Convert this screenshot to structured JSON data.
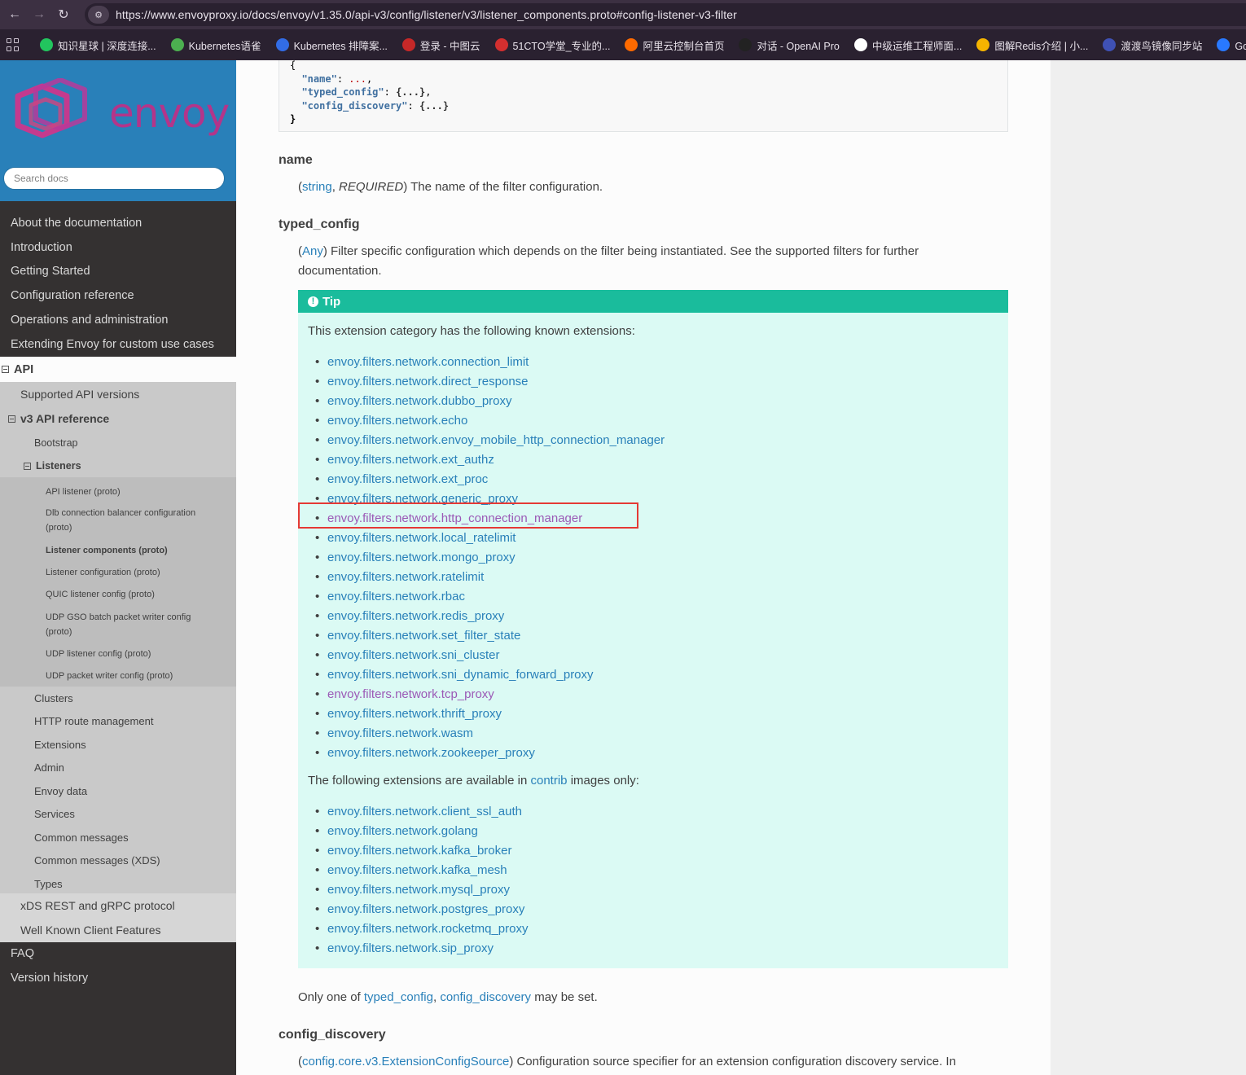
{
  "browser": {
    "url": "https://www.envoyproxy.io/docs/envoy/v1.35.0/api-v3/config/listener/v3/listener_components.proto#config-listener-v3-filter",
    "bookmarks": [
      {
        "label": "知识星球 | 深度连接...",
        "color": "#22c55e"
      },
      {
        "label": "Kubernetes语雀",
        "color": "#4caf50"
      },
      {
        "label": "Kubernetes 排障案...",
        "color": "#326ce5"
      },
      {
        "label": "登录 - 中图云",
        "color": "#c62828"
      },
      {
        "label": "51CTO学堂_专业的...",
        "color": "#d32f2f"
      },
      {
        "label": "阿里云控制台首页",
        "color": "#ff6a00"
      },
      {
        "label": "对话 - OpenAI Pro",
        "color": "#222222"
      },
      {
        "label": "中级运维工程师面...",
        "color": "#ffffff"
      },
      {
        "label": "图解Redis介绍 | 小...",
        "color": "#f5b400"
      },
      {
        "label": "渡渡鸟镜像同步站",
        "color": "#3f51b5"
      },
      {
        "label": "Go 学习",
        "color": "#2979ff"
      }
    ]
  },
  "sidebar": {
    "logo_text": "envoy",
    "search_placeholder": "Search docs",
    "top_items": [
      "About the documentation",
      "Introduction",
      "Getting Started",
      "Configuration reference",
      "Operations and administration",
      "Extending Envoy for custom use cases"
    ],
    "api_label": "API",
    "supported_versions": "Supported API versions",
    "v3_reference": "v3 API reference",
    "bootstrap": "Bootstrap",
    "listeners": "Listeners",
    "listener_children": [
      "API listener (proto)",
      "Dlb connection balancer configuration (proto)",
      "Listener components (proto)",
      "Listener configuration (proto)",
      "QUIC listener config (proto)",
      "UDP GSO batch packet writer config (proto)",
      "UDP listener config (proto)",
      "UDP packet writer config (proto)"
    ],
    "v3_children_after": [
      "Clusters",
      "HTTP route management",
      "Extensions",
      "Admin",
      "Envoy data",
      "Services",
      "Common messages",
      "Common messages (XDS)",
      "Types"
    ],
    "api_children_after": [
      "xDS REST and gRPC protocol",
      "Well Known Client Features"
    ],
    "bottom_items": [
      "FAQ",
      "Version history"
    ]
  },
  "content": {
    "code": {
      "open": "{",
      "name_key": "\"name\"",
      "typed_key": "\"typed_config\"",
      "discovery_key": "\"config_discovery\"",
      "name_val": "...",
      "obj_val": "{...}",
      "close": "}"
    },
    "name_title": "name",
    "name_type": "string",
    "name_required": "REQUIRED",
    "name_desc": ") The name of the filter configuration.",
    "typed_title": "typed_config",
    "typed_type": "Any",
    "typed_desc": ") Filter specific configuration which depends on the filter being instantiated. See the supported filters for further documentation.",
    "tip": {
      "label": "Tip",
      "intro": "This extension category has the following known extensions:",
      "extensions": [
        {
          "name": "envoy.filters.network.connection_limit",
          "visited": false
        },
        {
          "name": "envoy.filters.network.direct_response",
          "visited": false
        },
        {
          "name": "envoy.filters.network.dubbo_proxy",
          "visited": false
        },
        {
          "name": "envoy.filters.network.echo",
          "visited": false
        },
        {
          "name": "envoy.filters.network.envoy_mobile_http_connection_manager",
          "visited": false
        },
        {
          "name": "envoy.filters.network.ext_authz",
          "visited": false
        },
        {
          "name": "envoy.filters.network.ext_proc",
          "visited": false
        },
        {
          "name": "envoy.filters.network.generic_proxy",
          "visited": false
        },
        {
          "name": "envoy.filters.network.http_connection_manager",
          "visited": true
        },
        {
          "name": "envoy.filters.network.local_ratelimit",
          "visited": false
        },
        {
          "name": "envoy.filters.network.mongo_proxy",
          "visited": false
        },
        {
          "name": "envoy.filters.network.ratelimit",
          "visited": false
        },
        {
          "name": "envoy.filters.network.rbac",
          "visited": false
        },
        {
          "name": "envoy.filters.network.redis_proxy",
          "visited": false
        },
        {
          "name": "envoy.filters.network.set_filter_state",
          "visited": false
        },
        {
          "name": "envoy.filters.network.sni_cluster",
          "visited": false
        },
        {
          "name": "envoy.filters.network.sni_dynamic_forward_proxy",
          "visited": false
        },
        {
          "name": "envoy.filters.network.tcp_proxy",
          "visited": true
        },
        {
          "name": "envoy.filters.network.thrift_proxy",
          "visited": false
        },
        {
          "name": "envoy.filters.network.wasm",
          "visited": false
        },
        {
          "name": "envoy.filters.network.zookeeper_proxy",
          "visited": false
        }
      ],
      "contrib_intro_pre": "The following extensions are available in ",
      "contrib_link": "contrib",
      "contrib_intro_post": " images only:",
      "contrib_extensions": [
        "envoy.filters.network.client_ssl_auth",
        "envoy.filters.network.golang",
        "envoy.filters.network.kafka_broker",
        "envoy.filters.network.kafka_mesh",
        "envoy.filters.network.mysql_proxy",
        "envoy.filters.network.postgres_proxy",
        "envoy.filters.network.rocketmq_proxy",
        "envoy.filters.network.sip_proxy"
      ]
    },
    "only_one_pre": "Only one of ",
    "only_one_link1": "typed_config",
    "only_one_sep": ", ",
    "only_one_link2": "config_discovery",
    "only_one_post": " may be set.",
    "discovery_title": "config_discovery",
    "discovery_type": "config.core.v3.ExtensionConfigSource",
    "discovery_desc": ") Configuration source specifier for an extension configuration discovery service. In"
  },
  "colors": {
    "link": "#2980b9",
    "visited": "#9b59b6",
    "tip_header": "#1abc9c",
    "tip_body": "#dbfaf4",
    "sidebar_bg": "#343131",
    "sidebar_head": "#2980b9",
    "highlight": "#e53935"
  }
}
